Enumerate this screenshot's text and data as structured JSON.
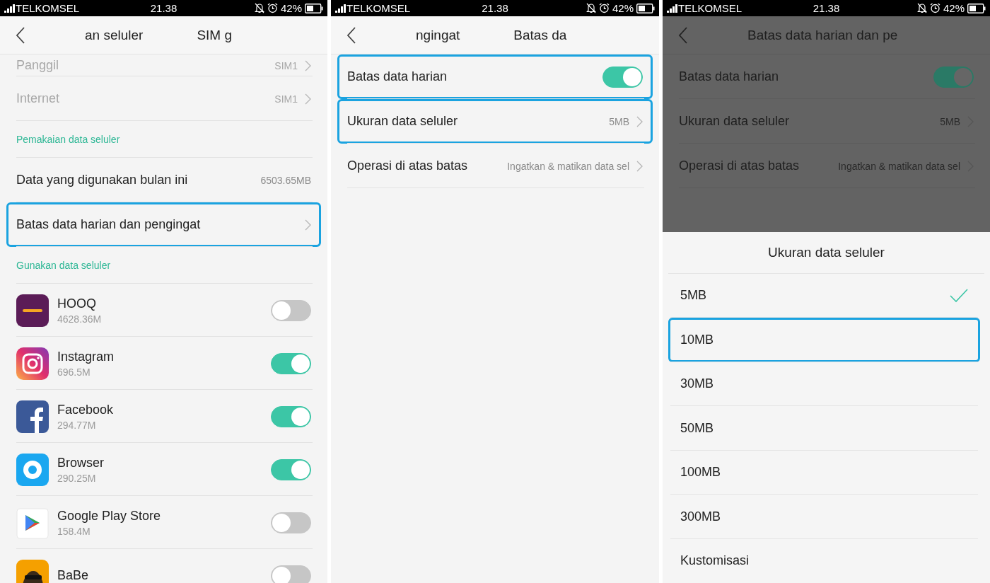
{
  "screens": [
    {
      "dimmed": false,
      "status_bar": {
        "carrier": "TELKOMSEL",
        "time": "21.38",
        "battery": "42%"
      },
      "header": {
        "titles": [
          "an seluler",
          "SIM g"
        ]
      },
      "rows": [
        {
          "kind": "setting",
          "label": "Panggil",
          "value": "SIM1",
          "chevron": true,
          "disabled": true,
          "highlighted": false
        },
        {
          "kind": "setting",
          "label": "Internet",
          "value": "SIM1",
          "chevron": true,
          "disabled": true,
          "highlighted": false
        },
        {
          "kind": "section",
          "label": "Pemakaian data seluler"
        },
        {
          "kind": "setting",
          "label": "Data yang digunakan bulan ini",
          "value": "6503.65MB",
          "chevron": false,
          "disabled": false,
          "highlighted": false
        },
        {
          "kind": "setting",
          "label": "Batas data harian dan pengingat",
          "chevron": true,
          "disabled": false,
          "highlighted": true
        },
        {
          "kind": "section",
          "label": "Gunakan data seluler"
        },
        {
          "kind": "app",
          "name": "HOOQ",
          "size": "4628.36M",
          "on": false
        },
        {
          "kind": "app",
          "name": "Instagram",
          "size": "696.5M",
          "on": true
        },
        {
          "kind": "app",
          "name": "Facebook",
          "size": "294.77M",
          "on": true
        },
        {
          "kind": "app",
          "name": "Browser",
          "size": "290.25M",
          "on": true
        },
        {
          "kind": "app",
          "name": "Google Play Store",
          "size": "158.4M",
          "on": false
        },
        {
          "kind": "app",
          "name": "BaBe",
          "on": false
        }
      ]
    },
    {
      "dimmed": false,
      "status_bar": {
        "carrier": "TELKOMSEL",
        "time": "21.38",
        "battery": "42%"
      },
      "header": {
        "titles": [
          "ngingat",
          "Batas da"
        ]
      },
      "rows": [
        {
          "kind": "switch",
          "label": "Batas data harian",
          "on": true,
          "highlighted": true
        },
        {
          "kind": "setting",
          "label": "Ukuran data seluler",
          "value": "5MB",
          "chevron": true,
          "disabled": false,
          "highlighted": true
        },
        {
          "kind": "setting",
          "label": "Operasi di atas batas",
          "value": "Ingatkan & matikan data sel",
          "chevron": true,
          "disabled": false,
          "highlighted": false
        }
      ]
    },
    {
      "dimmed": true,
      "status_bar": {
        "carrier": "TELKOMSEL",
        "time": "21.38",
        "battery": "42%"
      },
      "header": {
        "titles": [
          "Batas data harian dan pe"
        ]
      },
      "rows": [
        {
          "kind": "switch",
          "label": "Batas data harian",
          "on": true,
          "highlighted": false
        },
        {
          "kind": "setting",
          "label": "Ukuran data seluler",
          "value": "5MB",
          "chevron": true,
          "disabled": false,
          "highlighted": false
        },
        {
          "kind": "setting",
          "label": "Operasi di atas batas",
          "value": "Ingatkan & matikan data sel",
          "chevron": true,
          "disabled": false,
          "highlighted": false
        }
      ],
      "sheet": {
        "title": "Ukuran data seluler",
        "options": [
          {
            "label": "5MB",
            "selected": true,
            "highlighted": false
          },
          {
            "label": "10MB",
            "selected": false,
            "highlighted": true
          },
          {
            "label": "30MB",
            "selected": false,
            "highlighted": false
          },
          {
            "label": "50MB",
            "selected": false,
            "highlighted": false
          },
          {
            "label": "100MB",
            "selected": false,
            "highlighted": false
          },
          {
            "label": "300MB",
            "selected": false,
            "highlighted": false
          },
          {
            "label": "Kustomisasi",
            "selected": false,
            "highlighted": false
          }
        ]
      }
    }
  ]
}
